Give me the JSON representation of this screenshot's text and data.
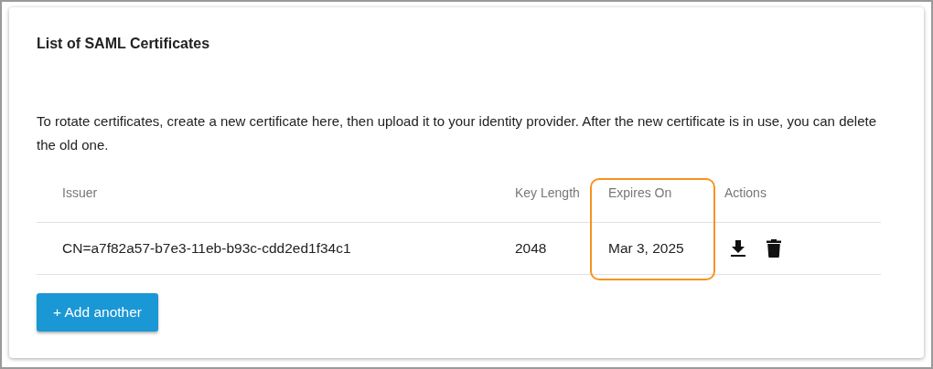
{
  "card": {
    "title": "List of SAML Certificates",
    "description": "To rotate certificates, create a new certificate here, then upload it to your identity provider. After the new certificate is in use, you can delete the old one.",
    "table": {
      "columns": [
        {
          "label": "Issuer",
          "highlighted": false
        },
        {
          "label": "Key Length",
          "highlighted": false
        },
        {
          "label": "Expires On",
          "highlighted": true
        },
        {
          "label": "Actions",
          "highlighted": false
        }
      ],
      "rows": [
        {
          "issuer": "CN=a7f82a57-b7e3-11eb-b93c-cdd2ed1f34c1",
          "key_length": "2048",
          "expires_on": "Mar 3, 2025",
          "actions": [
            {
              "kind": "download"
            },
            {
              "kind": "delete"
            }
          ]
        }
      ]
    },
    "add_button": "+ Add another"
  }
}
